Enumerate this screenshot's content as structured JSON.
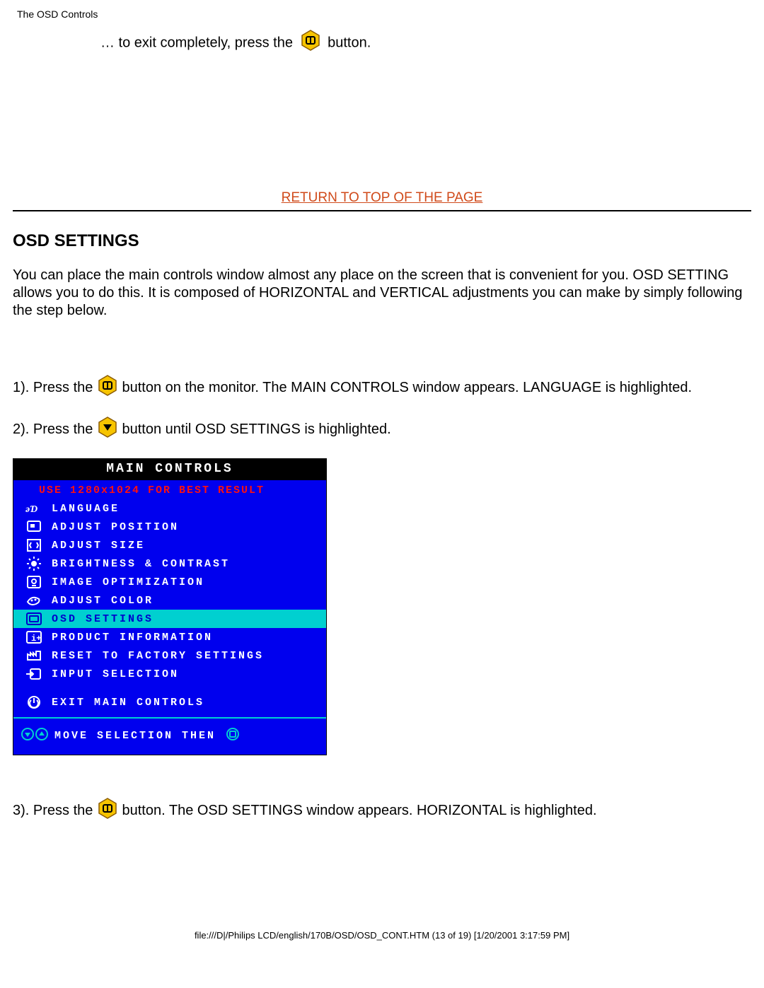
{
  "header": {
    "title": "The OSD Controls"
  },
  "intro": {
    "prefix": "… to exit completely, press the ",
    "suffix": " button."
  },
  "return_link": "RETURN TO TOP OF THE PAGE",
  "section_heading": "OSD SETTINGS",
  "section_body": "You can place the main controls window almost any place on the screen that is convenient for you. OSD SETTING allows you to do this. It is composed of HORIZONTAL and VERTICAL adjustments you can make by simply following the step below.",
  "step1": {
    "prefix": "1). Press the ",
    "suffix": " button on the monitor. The MAIN CONTROLS window appears. LANGUAGE is highlighted."
  },
  "step2": {
    "prefix": "2). Press the ",
    "suffix": " button until OSD SETTINGS is highlighted."
  },
  "step3": {
    "prefix": "3). Press the ",
    "suffix": " button. The OSD SETTINGS window appears. HORIZONTAL is highlighted."
  },
  "osd": {
    "title": "MAIN CONTROLS",
    "hint": "USE 1280x1024 FOR BEST RESULT",
    "items": [
      {
        "label": "LANGUAGE"
      },
      {
        "label": "ADJUST POSITION"
      },
      {
        "label": "ADJUST SIZE"
      },
      {
        "label": "BRIGHTNESS & CONTRAST"
      },
      {
        "label": "IMAGE OPTIMIZATION"
      },
      {
        "label": "ADJUST COLOR"
      },
      {
        "label": "OSD SETTINGS"
      },
      {
        "label": "PRODUCT INFORMATION"
      },
      {
        "label": "RESET TO FACTORY SETTINGS"
      },
      {
        "label": "INPUT SELECTION"
      }
    ],
    "exit_label": "EXIT MAIN CONTROLS",
    "footer_label": "MOVE SELECTION THEN"
  },
  "footer": "file:///D|/Philips LCD/english/170B/OSD/OSD_CONT.HTM (13 of 19) [1/20/2001 3:17:59 PM]"
}
